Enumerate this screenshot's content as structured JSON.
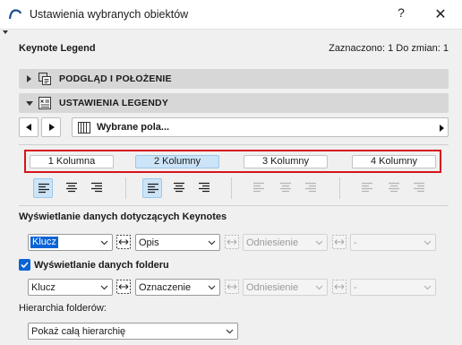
{
  "window": {
    "title": "Ustawienia wybranych obiektów",
    "help_label": "?",
    "close_label": "✕"
  },
  "header": {
    "left": "Keynote Legend",
    "right": "Zaznaczono: 1 Do zmian: 1"
  },
  "sections": {
    "preview": "PODGLĄD I POŁOŻENIE",
    "legend": "USTAWIENIA LEGENDY"
  },
  "nav": {
    "selected": "Wybrane pola..."
  },
  "columns": {
    "options": [
      "1 Kolumna",
      "2 Kolumny",
      "3 Kolumny",
      "4 Kolumny"
    ],
    "selected_index": 1
  },
  "keynote_display": {
    "label": "Wyświetlanie danych dotyczących Keynotes",
    "field1": "Klucz",
    "field2": "Opis",
    "field3": "Odniesienie",
    "field4": "-"
  },
  "folder_display": {
    "label": "Wyświetlanie danych folderu",
    "checked": true,
    "field1": "Klucz",
    "field2": "Oznaczenie",
    "field3": "Odniesienie",
    "field4": "-"
  },
  "hierarchy": {
    "label": "Hierarchia folderów:",
    "value": "Pokaż całą hierarchię"
  },
  "colors": {
    "highlight_box": "#d6141e",
    "selected_fill": "#cce4f7",
    "accent": "#0a63d6"
  }
}
